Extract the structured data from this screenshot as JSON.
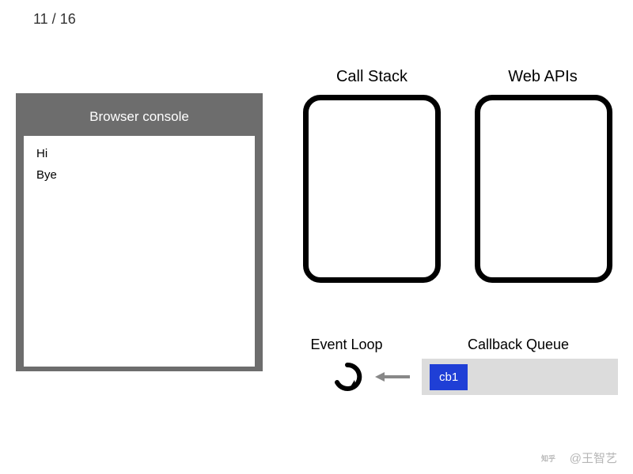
{
  "step": {
    "current": 11,
    "total": 16,
    "display": "11 / 16"
  },
  "console": {
    "title": "Browser console",
    "lines": [
      "Hi",
      "Bye"
    ]
  },
  "labels": {
    "callStack": "Call Stack",
    "webApis": "Web APIs",
    "eventLoop": "Event Loop",
    "callbackQueue": "Callback Queue"
  },
  "callStack": {
    "items": []
  },
  "webApis": {
    "items": []
  },
  "callbackQueue": {
    "items": [
      "cb1"
    ]
  },
  "watermark": {
    "text": "@王智艺",
    "platform": "知乎"
  }
}
